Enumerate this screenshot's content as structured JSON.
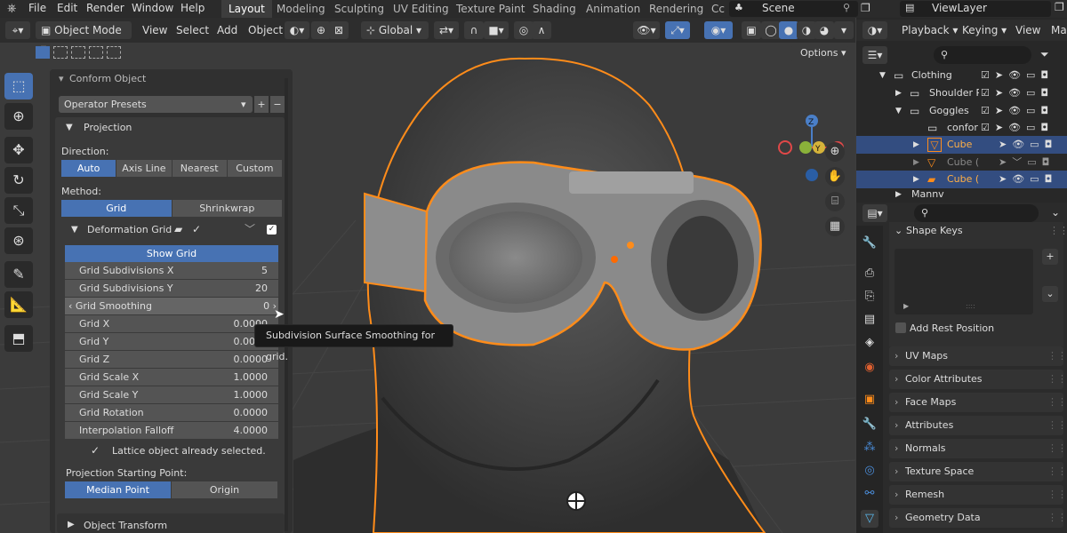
{
  "menubar": {
    "items": [
      "File",
      "Edit",
      "Render",
      "Window",
      "Help"
    ],
    "workspaces": [
      "Layout",
      "Modeling",
      "Sculpting",
      "UV Editing",
      "Texture Paint",
      "Shading",
      "Animation",
      "Rendering",
      "Cc"
    ],
    "active_workspace": "Layout",
    "scene": "Scene",
    "view_layer": "ViewLayer"
  },
  "header": {
    "mode": "Object Mode",
    "menus": [
      "View",
      "Select",
      "Add",
      "Object"
    ],
    "transform_orientation": "Global",
    "options": "Options"
  },
  "operator_panel": {
    "title": "Conform Object",
    "presets": "Operator Presets",
    "projection_section": "Projection",
    "direction_label": "Direction:",
    "direction_options": [
      "Auto",
      "Axis Line",
      "Nearest",
      "Custom"
    ],
    "direction_selected": "Auto",
    "method_label": "Method:",
    "method_options": [
      "Grid",
      "Shrinkwrap"
    ],
    "method_selected": "Grid",
    "deformation_grid": "Deformation Grid",
    "show_grid": "Show Grid",
    "fields": [
      {
        "label": "Grid Subdivisions X",
        "value": "5"
      },
      {
        "label": "Grid Subdivisions Y",
        "value": "20"
      },
      {
        "label": "Grid Smoothing",
        "value": "0"
      },
      {
        "label": "Grid X",
        "value": "0.0000"
      },
      {
        "label": "Grid Y",
        "value": "0.0000"
      },
      {
        "label": "Grid Z",
        "value": "0.0000"
      },
      {
        "label": "Grid Scale X",
        "value": "1.0000"
      },
      {
        "label": "Grid Scale Y",
        "value": "1.0000"
      },
      {
        "label": "Grid Rotation",
        "value": "0.0000"
      },
      {
        "label": "Interpolation Falloff",
        "value": "4.0000"
      }
    ],
    "lattice_note": "Lattice object already selected.",
    "starting_point_label": "Projection Starting Point:",
    "starting_point_options": [
      "Median Point",
      "Origin"
    ],
    "starting_point_selected": "Median Point",
    "object_transform": "Object Transform"
  },
  "tooltip": "Subdivision Surface Smoothing for grid.",
  "outliner": {
    "header_menus": [
      "Playback",
      "Keying",
      "View",
      "Mar"
    ],
    "rows": [
      {
        "name": "Clothing",
        "indent": 1,
        "selected": false
      },
      {
        "name": "Shoulder P",
        "indent": 2,
        "selected": false
      },
      {
        "name": "Goggles",
        "indent": 2,
        "selected": false
      },
      {
        "name": "confor",
        "indent": 3,
        "selected": false
      },
      {
        "name": "Cube",
        "indent": 3,
        "selected": true
      },
      {
        "name": "Cube (",
        "indent": 3,
        "selected": false
      },
      {
        "name": "Cube (",
        "indent": 3,
        "selected": true
      },
      {
        "name": "Mannv",
        "indent": 1,
        "selected": false
      }
    ]
  },
  "properties": {
    "shape_keys": "Shape Keys",
    "add_rest_position": "Add Rest Position",
    "categories": [
      "UV Maps",
      "Color Attributes",
      "Face Maps",
      "Attributes",
      "Normals",
      "Texture Space",
      "Remesh",
      "Geometry Data"
    ]
  },
  "colors": {
    "accent": "#4772b3",
    "selection_outline": "#ff8c1a",
    "panel_bg": "#303030"
  }
}
